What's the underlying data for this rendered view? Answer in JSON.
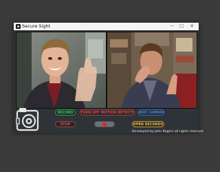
{
  "window": {
    "title": "Secure Sight",
    "minimize_glyph": "─",
    "maximize_glyph": "☐",
    "close_glyph": "✕"
  },
  "feeds": [
    {
      "name": "camera-feed-1"
    },
    {
      "name": "camera-feed-2"
    }
  ],
  "controls": {
    "record_label": "RECORD",
    "motion_label": "TURN OFF MOTION DETECTION",
    "add_camera_label": "ADD CAMERA",
    "stop_label": "STOP",
    "open_records_label": "OPEN RECORDS",
    "recording_indicator": "recording-toggle"
  },
  "footer": {
    "credit": "Developed by John Rogers all rights reserved"
  },
  "colors": {
    "record": "#3fcf5c",
    "motion": "#e04a4a",
    "add_camera": "#4b8fe0",
    "open_records": "#f0c040",
    "rec_dot": "#ff1a1a"
  }
}
